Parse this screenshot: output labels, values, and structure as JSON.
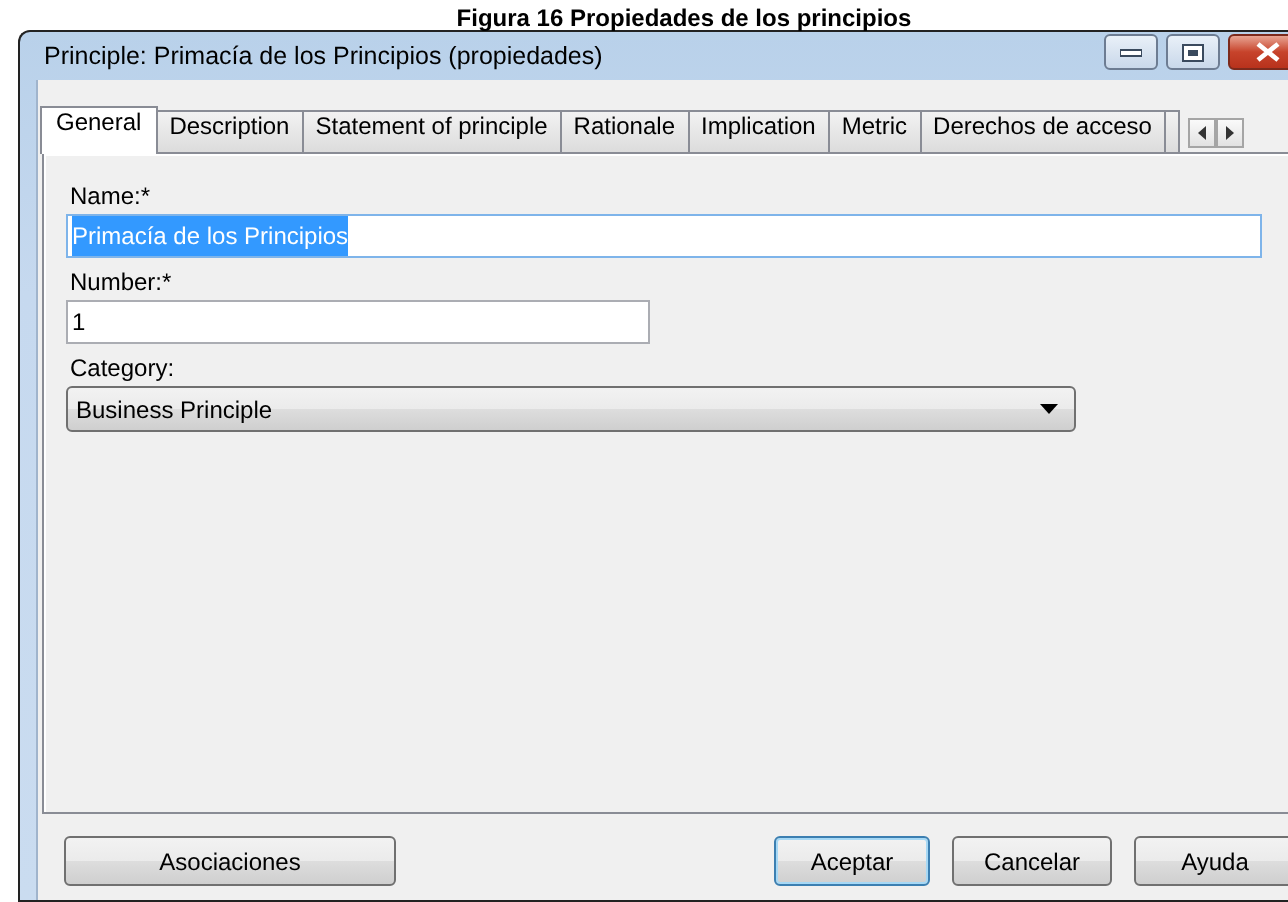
{
  "caption": "Figura 16 Propiedades de los principios",
  "window": {
    "title": "Principle: Primacía de los Principios (propiedades)"
  },
  "tabs": [
    {
      "label": "General",
      "selected": true
    },
    {
      "label": "Description",
      "selected": false
    },
    {
      "label": "Statement of principle",
      "selected": false
    },
    {
      "label": "Rationale",
      "selected": false
    },
    {
      "label": "Implication",
      "selected": false
    },
    {
      "label": "Metric",
      "selected": false
    },
    {
      "label": "Derechos de acceso",
      "selected": false
    }
  ],
  "fields": [
    {
      "kind": "text",
      "label": "Name:*",
      "value": "Primacía de los Principios",
      "text_selected": true
    },
    {
      "kind": "text",
      "label": "Number:*",
      "value": "1",
      "text_selected": false
    },
    {
      "kind": "select",
      "label": "Category:",
      "value": "Business Principle"
    }
  ],
  "buttons": [
    {
      "label": "Asociaciones",
      "default": false
    },
    {
      "label": "Aceptar",
      "default": true
    },
    {
      "label": "Cancelar",
      "default": false
    },
    {
      "label": "Ayuda",
      "default": false
    }
  ]
}
